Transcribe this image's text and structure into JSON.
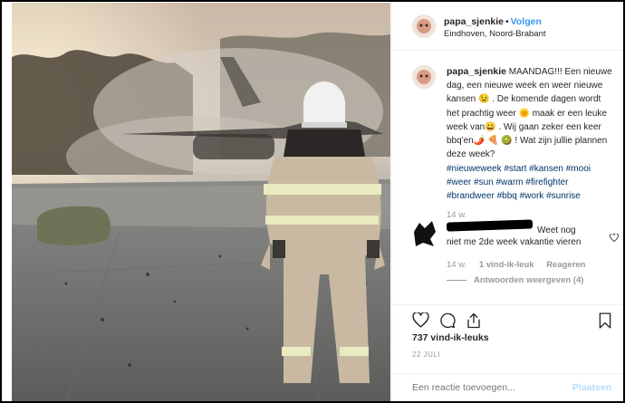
{
  "post": {
    "username": "papa_sjenkie",
    "separator": "•",
    "follow_label": "Volgen",
    "location": "Eindhoven, Noord-Brabant"
  },
  "caption": {
    "username": "papa_sjenkie",
    "text": "MAANDAG!!! Een nieuwe dag, een nieuwe week en weer nieuwe kansen 😉 . De komende dagen wordt het prachtig weer 🌞 maak er een leuke week van😀 . Wij gaan zeker een keer bbq'en🌶️ 🍕 🥝 ! Wat zijn jullie plannen deze week?",
    "hashtags": "#nieuweweek #start #kansen #mooi #weer #sun #warm #firefighter #brandweer #bbq #work #sunrise",
    "age": "14 w."
  },
  "comment": {
    "text_part1": "Weet nog",
    "text_part2": "niet me 2de week vakantie vieren",
    "age": "14 w.",
    "likes": "1 vind-ik-leuk",
    "reply_label": "Reageren",
    "view_replies_label": "Antwoorden weergeven (4)"
  },
  "actions": {
    "like_icon": "heart-icon",
    "comment_icon": "comment-icon",
    "share_icon": "share-icon",
    "save_icon": "bookmark-icon",
    "likes_count": "737 vind-ik-leuks",
    "date": "22 JULI"
  },
  "add_comment": {
    "placeholder": "Een reactie toevoegen...",
    "post_label": "Plaatsen"
  },
  "colors": {
    "accent": "#3897f0",
    "hashtag": "#003569",
    "muted": "#999999",
    "post_disabled": "#b2dffc"
  }
}
